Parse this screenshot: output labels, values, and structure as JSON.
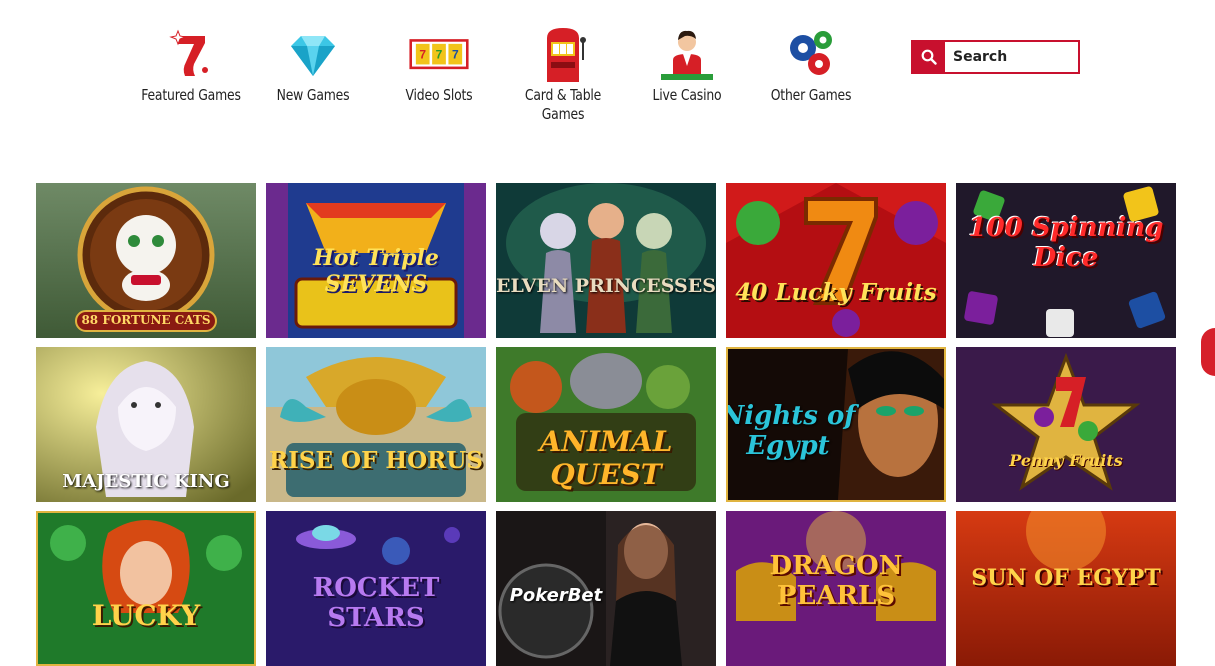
{
  "nav": {
    "items": [
      {
        "label": "Featured Games",
        "icon": "lucky-seven-icon"
      },
      {
        "label": "New Games",
        "icon": "diamond-icon"
      },
      {
        "label": "Video Slots",
        "icon": "slot-reels-icon"
      },
      {
        "label": "Card & Table\nGames",
        "icon": "slot-machine-icon"
      },
      {
        "label": "Live Casino",
        "icon": "dealer-icon"
      },
      {
        "label": "Other Games",
        "icon": "gears-icon"
      }
    ]
  },
  "search": {
    "placeholder": "Search",
    "icon": "search-icon"
  },
  "games": [
    {
      "title": "88 FORTUNE CATS"
    },
    {
      "title": "Hot Triple SEVENS"
    },
    {
      "title": "ELVEN PRINCESSES"
    },
    {
      "title": "40 Lucky Fruits"
    },
    {
      "title": "100 Spinning Dice"
    },
    {
      "title": "MAJESTIC KING"
    },
    {
      "title": "RISE OF HORUS"
    },
    {
      "title": "ANIMAL QUEST"
    },
    {
      "title": "Nights of Egypt"
    },
    {
      "title": "Penny Fruits"
    },
    {
      "title": "LUCKY"
    },
    {
      "title": "ROCKET STARS"
    },
    {
      "title": "PokerBet"
    },
    {
      "title": "DRAGON PEARLS"
    },
    {
      "title": "SUN OF EGYPT"
    }
  ],
  "colors": {
    "accent": "#c8102e"
  }
}
